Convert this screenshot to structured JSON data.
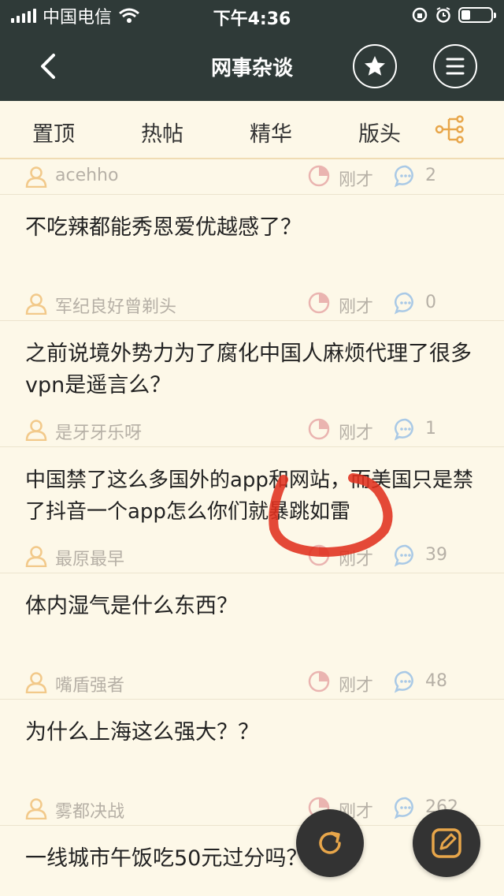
{
  "status_bar": {
    "carrier": "中国电信",
    "time": "下午4:36",
    "battery_level": 0.3
  },
  "nav": {
    "title": "网事杂谈",
    "back_icon": "chevron-left-icon",
    "favorite_icon": "star-icon",
    "menu_icon": "menu-icon"
  },
  "tabs": [
    "置顶",
    "热帖",
    "精华",
    "版头"
  ],
  "colors": {
    "header_bg": "#2f3a38",
    "page_bg": "#fdf8e8",
    "accent": "#e8a64a",
    "meta_text": "#b6b0a6",
    "annotation": "#e0301e"
  },
  "first_meta": {
    "author": "acehho",
    "time": "刚才",
    "replies": "2"
  },
  "posts": [
    {
      "title": "不吃辣都能秀恩爱优越感了？",
      "author": "军纪良好曾剃头",
      "time": "刚才",
      "replies": "0"
    },
    {
      "title": "之前说境外势力为了腐化中国人麻烦代理了很多vpn是遥言么？",
      "author": "是牙牙乐呀",
      "time": "刚才",
      "replies": "1"
    },
    {
      "title": "中国禁了这么多国外的app和网站，而美国只是禁了抖音一个app怎么你们就暴跳如雷",
      "author": "最原最早",
      "time": "刚才",
      "replies": "39"
    },
    {
      "title": "体内湿气是什么东西？",
      "author": "嘴盾强者",
      "time": "刚才",
      "replies": "48"
    },
    {
      "title": "为什么上海这么强大？？",
      "author": "雾都决战",
      "time": "刚才",
      "replies": "262"
    },
    {
      "title": "一线城市午饭吃50元过分吗？",
      "author": "",
      "time": "",
      "replies": ""
    }
  ]
}
